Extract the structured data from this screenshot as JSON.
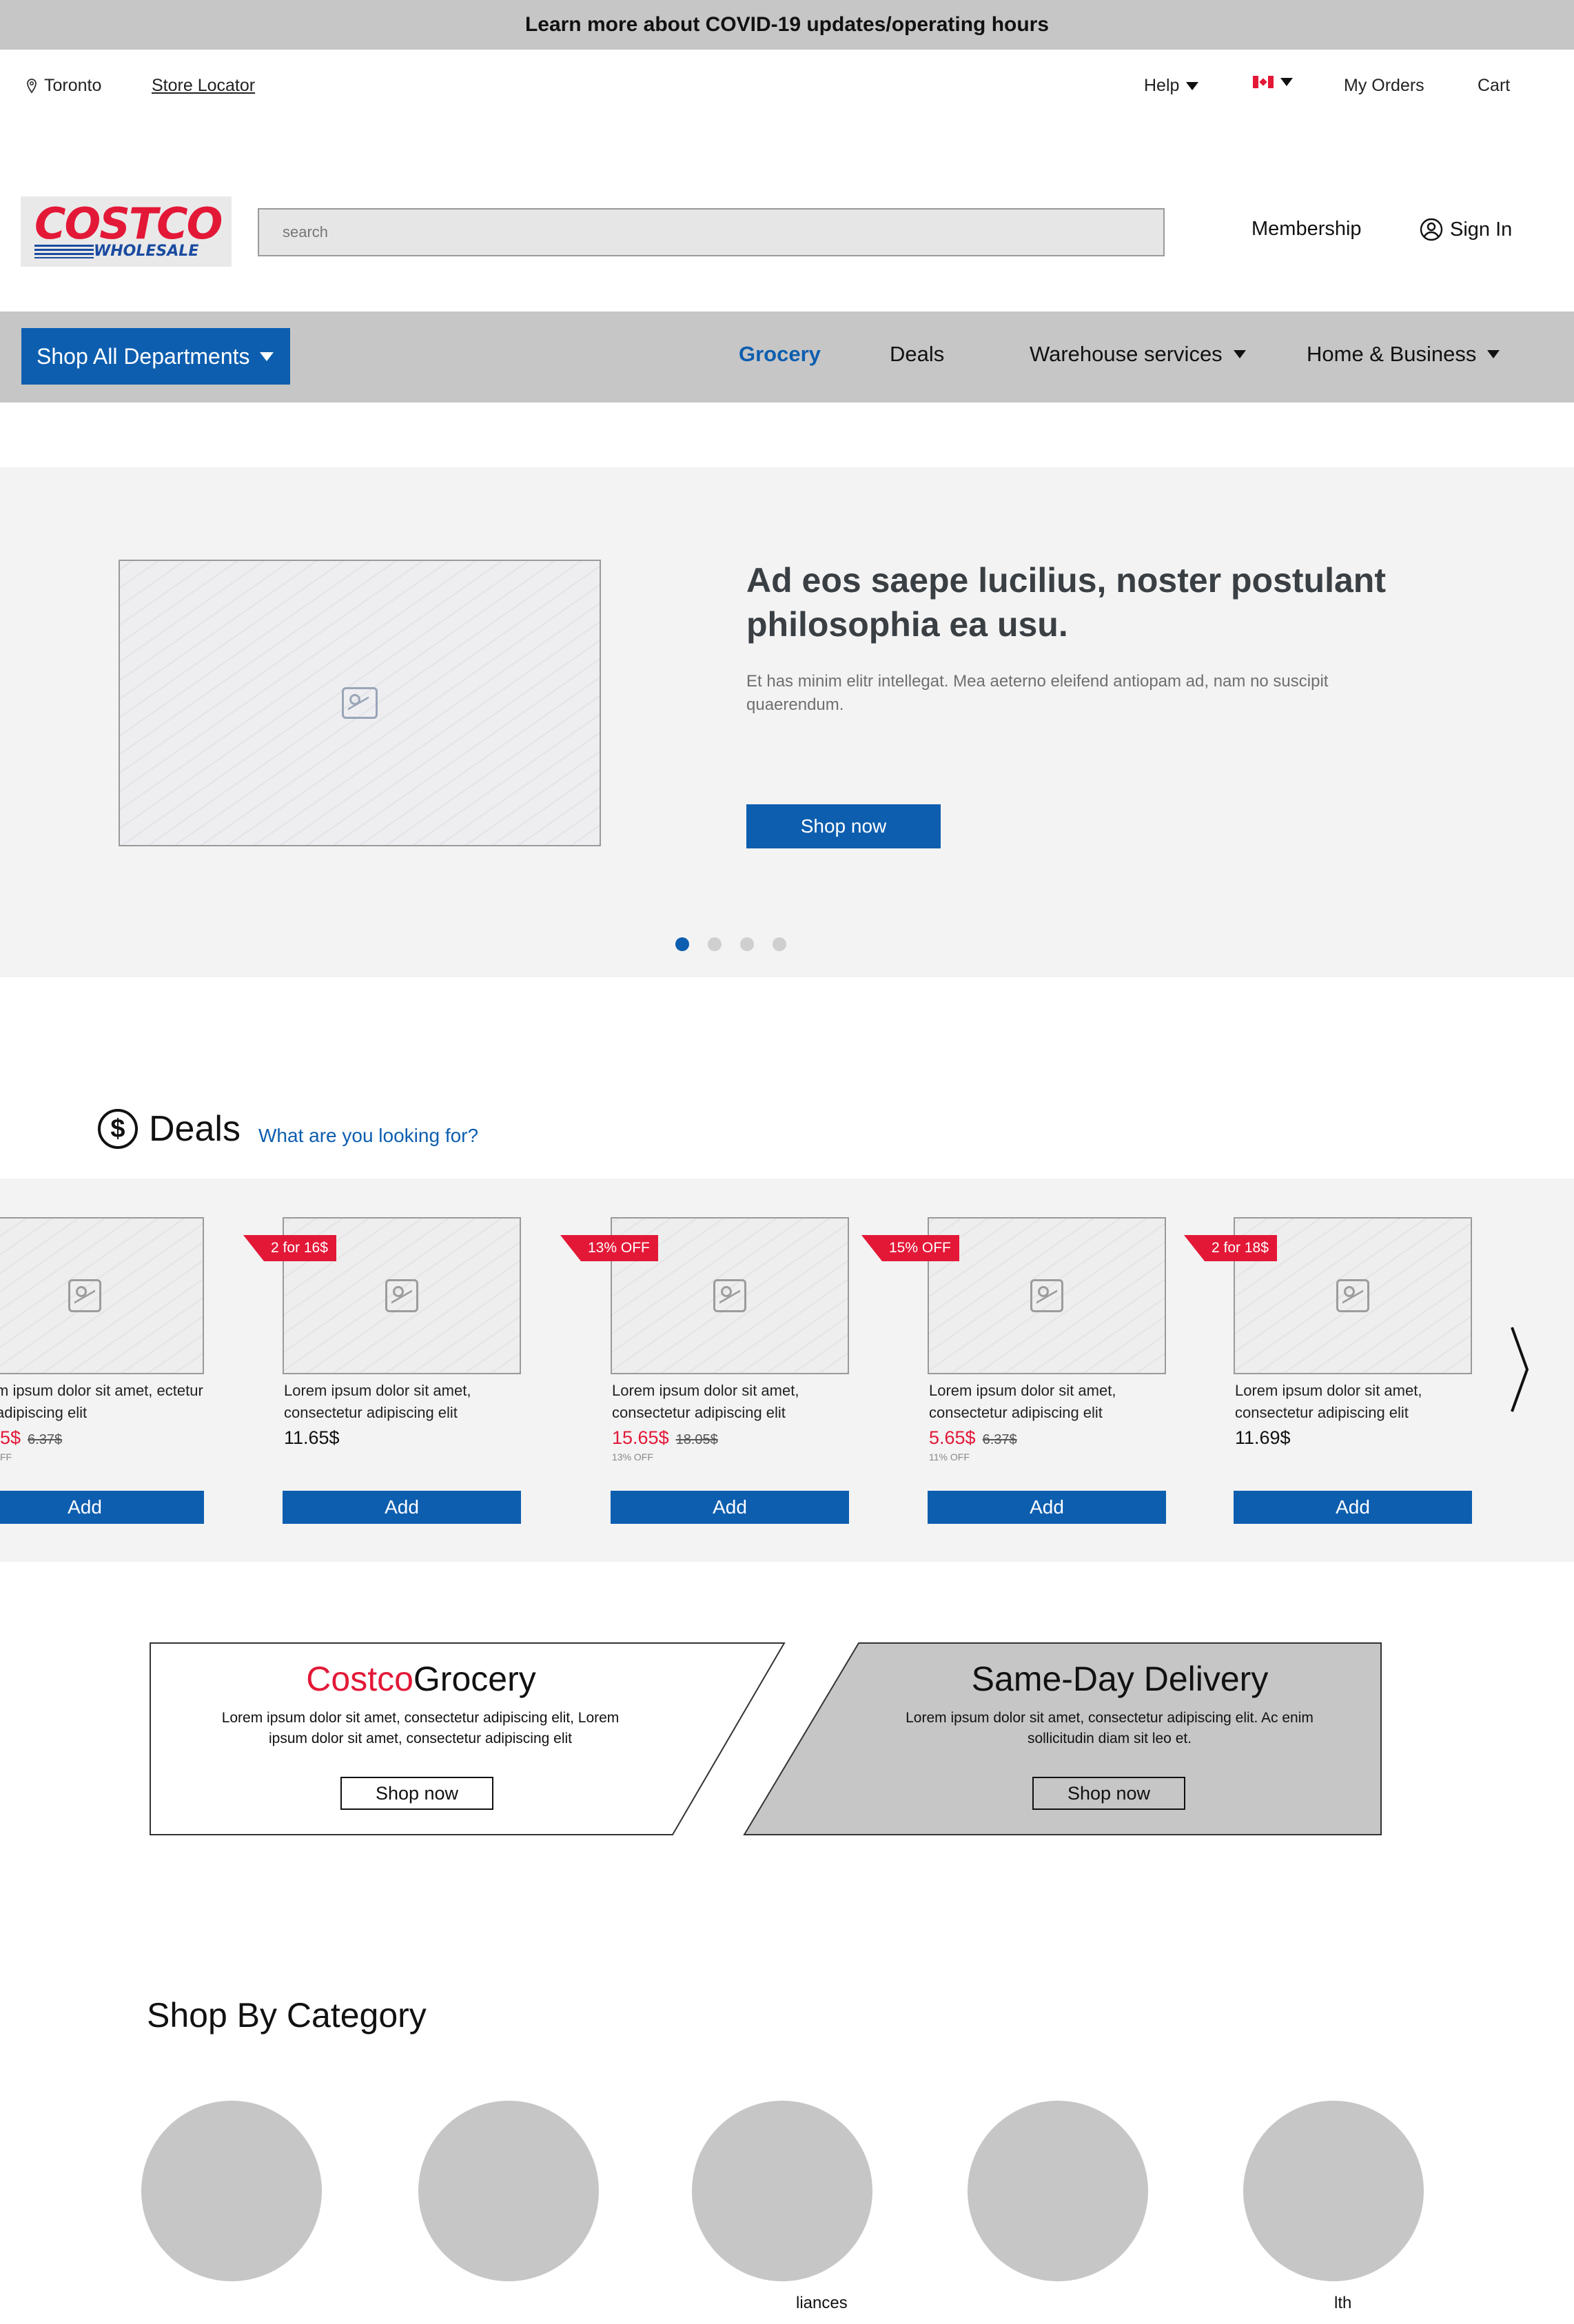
{
  "banner": {
    "text": "Learn more about COVID-19 updates/operating hours"
  },
  "utility": {
    "location": "Toronto",
    "store_locator": "Store Locator",
    "help": "Help",
    "my_orders": "My Orders",
    "cart": "Cart"
  },
  "header": {
    "logo_main": "COSTCO",
    "logo_sub": "WHOLESALE",
    "search_placeholder": "search",
    "membership": "Membership",
    "sign_in": "Sign In"
  },
  "nav": {
    "shop_all": "Shop All Departments",
    "links": [
      "Grocery",
      "Deals",
      "Warehouse services",
      "Home & Business"
    ],
    "active_link": "Grocery"
  },
  "hero": {
    "title": "Ad eos saepe lucilius, noster postulant philosophia ea usu.",
    "body": "Et has minim elitr intellegat. Mea aeterno eleifend antiopam ad, nam no suscipit quaerendum.",
    "cta": "Shop now",
    "slides": 4,
    "active_slide": 1
  },
  "deals": {
    "title": "Deals",
    "link": "What are you looking for?",
    "cards": [
      {
        "desc": "m ipsum dolor sit amet, ectetur adipiscing elit",
        "price": "5$",
        "old_price": "6.37$",
        "off": "FF",
        "tag": "",
        "add": "Add"
      },
      {
        "desc": "Lorem ipsum dolor sit amet, consectetur adipiscing elit",
        "price": "11.65$",
        "old_price": "",
        "off": "",
        "tag": "2 for 16$",
        "add": "Add"
      },
      {
        "desc": "Lorem ipsum dolor sit amet, consectetur adipiscing elit",
        "price": "15.65$",
        "old_price": "18.05$",
        "off": "13% OFF",
        "tag": "13% OFF",
        "add": "Add"
      },
      {
        "desc": "Lorem ipsum dolor sit amet, consectetur adipiscing elit",
        "price": "5.65$",
        "old_price": "6.37$",
        "off": "11% OFF",
        "tag": "15% OFF",
        "add": "Add"
      },
      {
        "desc": "Lorem ipsum dolor sit amet, consectetur adipiscing elit",
        "price": "11.69$",
        "old_price": "",
        "off": "",
        "tag": "2 for 18$",
        "add": "Add"
      }
    ]
  },
  "promos": [
    {
      "title_red": "Costco",
      "title_black": "Grocery",
      "body": "Lorem ipsum dolor sit amet, consectetur adipiscing elit, Lorem ipsum dolor sit amet, consectetur adipiscing elit",
      "cta": "Shop now"
    },
    {
      "title": "Same-Day Delivery",
      "body": "Lorem ipsum dolor sit amet, consectetur adipiscing elit. Ac enim sollicitudin diam sit leo et.",
      "cta": "Shop now"
    }
  ],
  "categories": {
    "title": "Shop By Category",
    "labels": [
      "",
      "",
      "liances",
      "",
      "lth"
    ]
  },
  "colors": {
    "brand_blue": "#0d5eaf",
    "brand_red": "#e31837",
    "grey_bar": "#c6c6c6"
  }
}
